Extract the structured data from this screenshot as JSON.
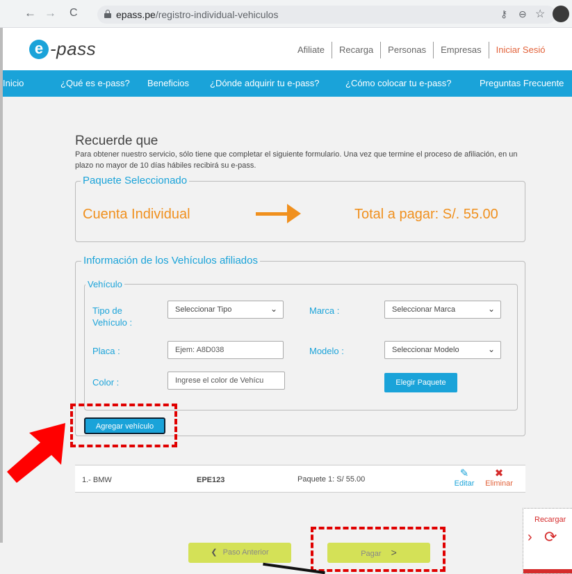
{
  "browser": {
    "back_icon": "←",
    "forward_icon": "→",
    "reload_icon": "C",
    "url_domain": "epass.pe",
    "url_path": "/registro-individual-vehiculos",
    "key_icon": "⚷",
    "zoom_icon": "⊖",
    "star_icon": "☆"
  },
  "header": {
    "logo_e": "e",
    "logo_pass": "-pass",
    "menu": [
      "Afiliate",
      "Recarga",
      "Personas",
      "Empresas",
      "Iniciar Sesió"
    ]
  },
  "nav": [
    "Inicio",
    "¿Qué es e-pass?",
    "Beneficios",
    "¿Dónde adquirir tu e-pass?",
    "¿Cómo colocar tu e-pass?",
    "Preguntas Frecuente"
  ],
  "page": {
    "heading": "Recuerde que",
    "intro": "Para obtener nuestro servicio, sólo tiene que completar el siguiente formulario. Una vez que termine el proceso de afiliación, en un plazo no mayor de 10 días hábiles recibirá su e-pass.",
    "paquete_legend": "Paquete Seleccionado",
    "cuenta": "Cuenta Individual",
    "total": "Total a pagar: S/. 55.00",
    "info_legend": "Información de los Vehículos afiliados",
    "vehiculo_legend": "Vehículo"
  },
  "form": {
    "tipo_label": "Tipo de Vehículo :",
    "tipo_value": "Seleccionar Tipo",
    "marca_label": "Marca :",
    "marca_value": "Seleccionar Marca",
    "placa_label": "Placa :",
    "placa_placeholder": "Ejem: A8D038",
    "modelo_label": "Modelo :",
    "modelo_value": "Seleccionar Modelo",
    "color_label": "Color :",
    "color_placeholder": "Ingrese el color de Vehícu",
    "elegir_paquete": "Elegir Paquete",
    "agregar": "Agregar vehículo"
  },
  "vehicles": [
    {
      "name": "1.- BMW",
      "placa": "EPE123",
      "paquete": "Paquete 1: S/ 55.00",
      "edit": "Editar",
      "delete": "Eliminar"
    }
  ],
  "footer": {
    "prev": "Paso Anterior",
    "pay": "Pagar",
    "prev_icon": "❮",
    "pay_icon": ">"
  },
  "reload": {
    "label": "Recargar",
    "icon": "⟳"
  },
  "colors": {
    "brand_blue": "#1aa3d9",
    "orange": "#f0901e",
    "lime": "#d4e157",
    "annotation_red": "#e00000"
  }
}
